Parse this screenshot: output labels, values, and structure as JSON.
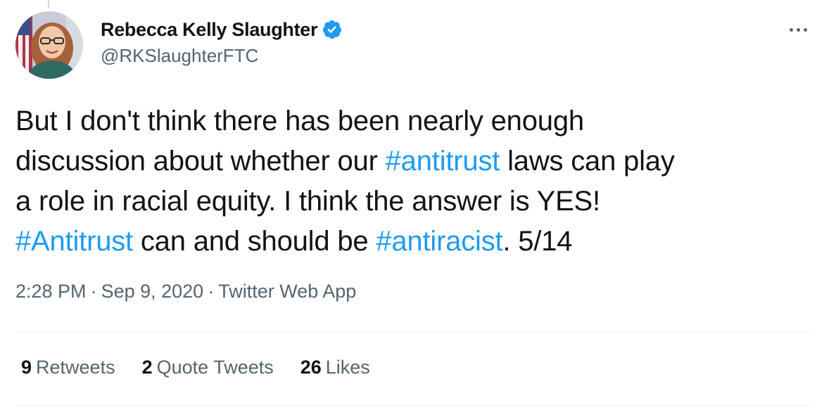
{
  "author": {
    "name": "Rebecca Kelly Slaughter",
    "handle": "@RKSlaughterFTC",
    "verified_icon": "verified-badge-icon"
  },
  "more_icon": "more-horizontal-icon",
  "tweet": {
    "line1": "But I don't think there has been nearly enough",
    "line2_pre": "discussion about whether our ",
    "line2_tag": "#antitrust",
    "line2_post": " laws can play",
    "line3": "a role in racial equity. I think the answer is YES!",
    "line4_tag1": "#Antitrust",
    "line4_mid": " can and should be ",
    "line4_tag2": "#antiracist",
    "line4_post": ". 5/14"
  },
  "meta": {
    "time": "2:28 PM",
    "date": "Sep 9, 2020",
    "source": "Twitter Web App",
    "separator": "·"
  },
  "stats": {
    "retweets_count": "9",
    "retweets_label": "Retweets",
    "quotes_count": "2",
    "quotes_label": "Quote Tweets",
    "likes_count": "26",
    "likes_label": "Likes"
  },
  "colors": {
    "link": "#1d9bf0",
    "secondary_text": "#536471",
    "primary_text": "#0f1419",
    "divider": "#eff3f4"
  }
}
